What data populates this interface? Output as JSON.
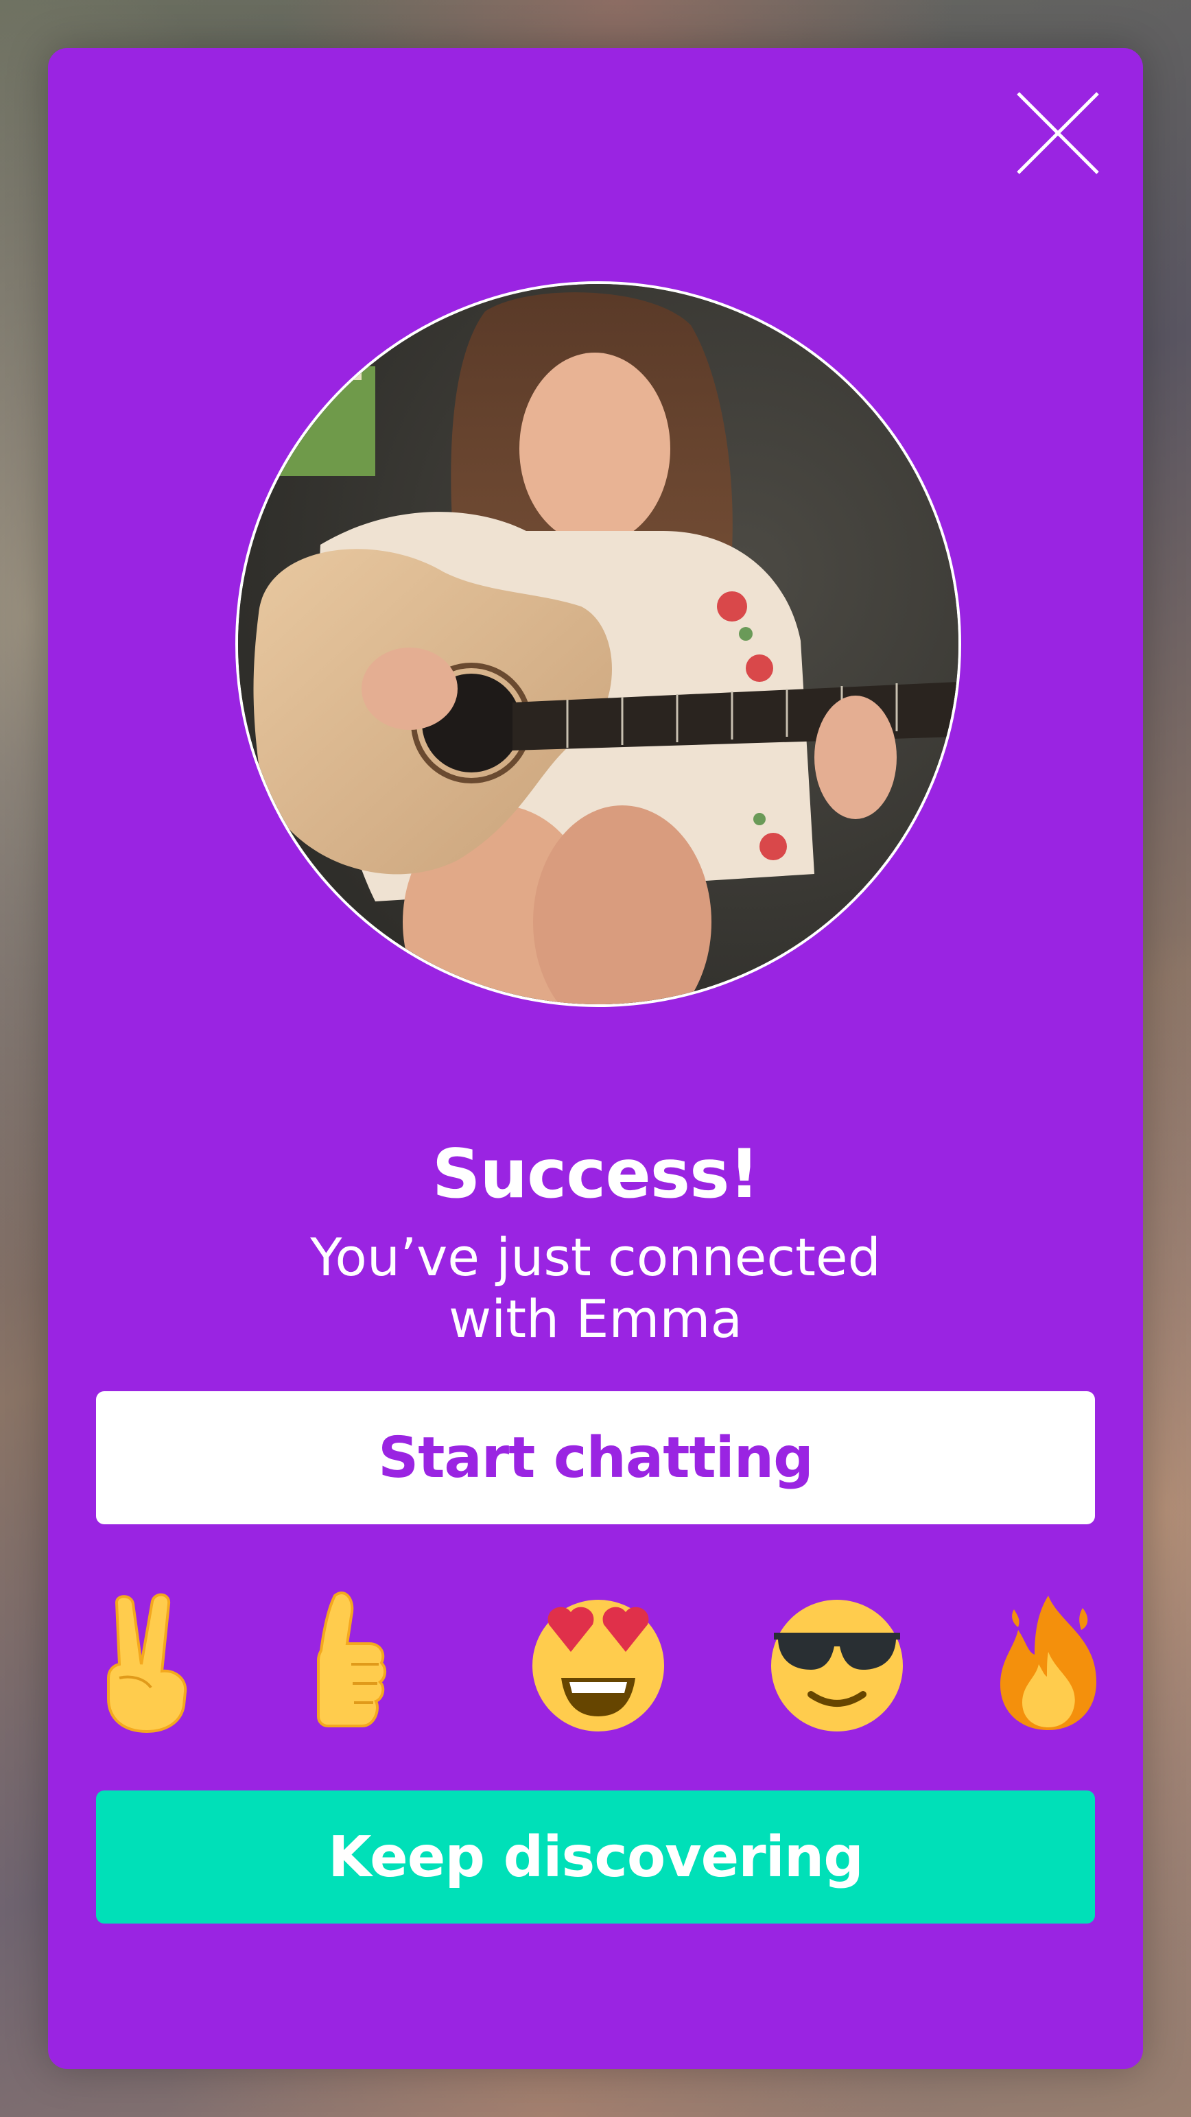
{
  "dialog": {
    "title": "Success!",
    "subtitle_line1": "You’ve just connected",
    "subtitle_line2": "with Emma",
    "primary_button": "Start chatting",
    "secondary_button": "Keep discovering"
  },
  "reactions": [
    "victory-hand-icon",
    "thumbs-up-icon",
    "heart-eyes-icon",
    "sunglasses-icon",
    "fire-icon"
  ],
  "colors": {
    "card": "#9a24e2",
    "primary_button_bg": "#ffffff",
    "primary_button_text": "#9a24e2",
    "secondary_button_bg": "#00e0b8",
    "secondary_button_text": "#ffffff",
    "emoji_yellow": "#ffcc4d"
  }
}
